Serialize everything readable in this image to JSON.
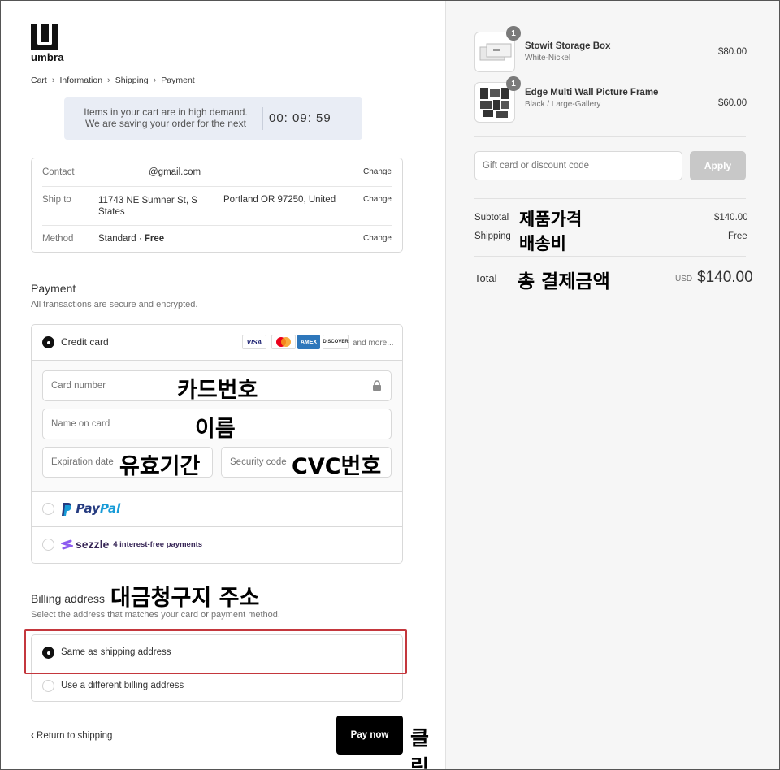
{
  "store": {
    "logo_text": "umbra"
  },
  "breadcrumb": [
    "Cart",
    "Information",
    "Shipping",
    "Payment"
  ],
  "timer": {
    "message_line1": "Items in your cart are in high demand.",
    "message_line2": "We are saving your order for the next",
    "clock": "00: 09: 59"
  },
  "review": {
    "contact_label": "Contact",
    "contact_value": "@gmail.com",
    "contact_change": "Change",
    "ship_label": "Ship to",
    "ship_value_line1": "11743 NE Sumner St, S",
    "ship_value_line2": "States",
    "ship_value_city": "Portland OR 97250, United",
    "ship_change": "Change",
    "method_label": "Method",
    "method_value": "Standard · ",
    "method_free": "Free",
    "method_change": "Change"
  },
  "payment": {
    "title": "Payment",
    "subtitle": "All transactions are secure and encrypted.",
    "credit_card_label": "Credit card",
    "card_badges": [
      "VISA",
      "AMEX",
      "DISCOVER"
    ],
    "and_more": "and more...",
    "card_number_placeholder": "Card number",
    "name_placeholder": "Name on card",
    "expiry_placeholder": "Expiration date",
    "security_placeholder": "Security code",
    "paypal_pay": "Pay",
    "paypal_pal": "Pal",
    "sezzle_name": "sezzle",
    "sezzle_note": "4 interest-free payments"
  },
  "billing": {
    "title": "Billing address",
    "subtitle": "Select the address that matches your card or payment method.",
    "same_option": "Same as shipping address",
    "different_option": "Use a different billing address"
  },
  "footer": {
    "return_link": "Return to shipping",
    "pay_button": "Pay now"
  },
  "annotations": {
    "card_number": "카드번호",
    "name": "이름",
    "expiry": "유효기간",
    "cvc": "CVC번호",
    "billing": "대금청구지 주소",
    "click": "클릭",
    "subtotal": "제품가격",
    "shipping": "배송비",
    "total": "총 결제금액"
  },
  "cart": {
    "items": [
      {
        "name": "Stowit Storage Box",
        "variant": "White-Nickel",
        "price": "$80.00",
        "qty": "1"
      },
      {
        "name": "Edge Multi Wall Picture Frame",
        "variant": "Black / Large-Gallery",
        "price": "$60.00",
        "qty": "1"
      }
    ],
    "gift_placeholder": "Gift card or discount code",
    "apply_label": "Apply",
    "subtotal_label": "Subtotal",
    "subtotal_value": "$140.00",
    "shipping_label": "Shipping",
    "shipping_value": "Free",
    "total_label": "Total",
    "currency": "USD",
    "total_value": "$140.00"
  },
  "colors": {
    "accent_red": "#c4373d",
    "timer_bg": "#e9edf5",
    "sidebar_bg": "#f6f6f6"
  }
}
